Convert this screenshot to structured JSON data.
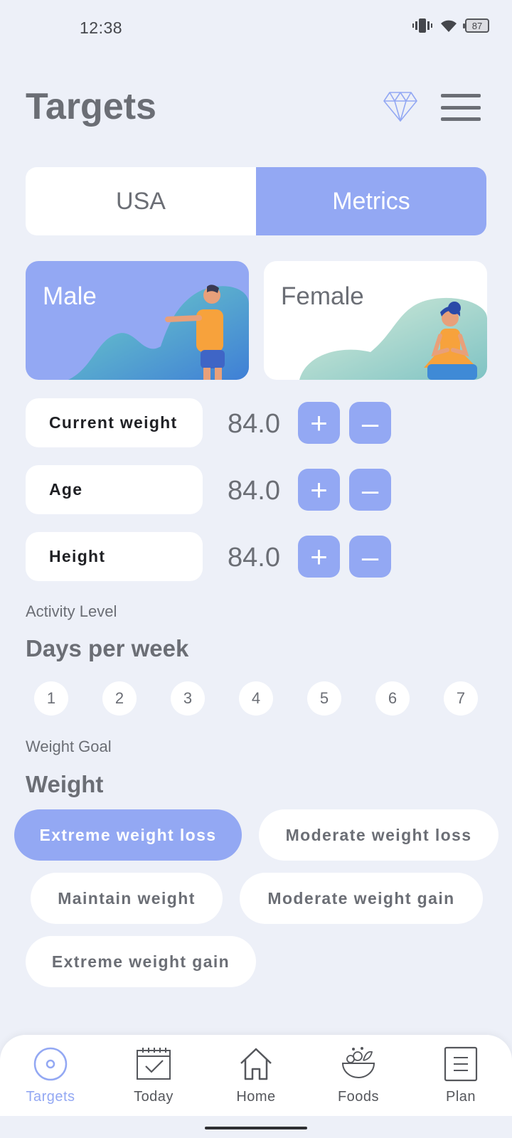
{
  "status_bar": {
    "time": "12:38",
    "battery": "87",
    "icons": [
      "vibrate-icon",
      "wifi-icon",
      "battery-icon"
    ]
  },
  "header": {
    "title": "Targets",
    "premium_icon": "diamond-icon",
    "menu_icon": "hamburger-menu-icon"
  },
  "unit_toggle": {
    "options": [
      "USA",
      "Metrics"
    ],
    "selected": "Metrics"
  },
  "gender": {
    "male": "Male",
    "female": "Female",
    "selected": "Male"
  },
  "metrics": [
    {
      "label": "Current weight",
      "value": "84.0"
    },
    {
      "label": "Age",
      "value": "84.0"
    },
    {
      "label": "Height",
      "value": "84.0"
    }
  ],
  "stepper": {
    "plus": "+",
    "minus": "–"
  },
  "activity": {
    "subtitle": "Activity Level",
    "title": "Days per week",
    "days": [
      "1",
      "2",
      "3",
      "4",
      "5",
      "6",
      "7"
    ]
  },
  "weight_goal": {
    "subtitle": "Weight Goal",
    "title": "Weight",
    "options": [
      "Extreme weight loss",
      "Moderate weight loss",
      "Maintain weight",
      "Moderate weight gain",
      "Extreme weight gain"
    ],
    "selected": "Extreme weight loss"
  },
  "bottom_nav": {
    "items": [
      {
        "label": "Targets",
        "icon": "target-icon"
      },
      {
        "label": "Today",
        "icon": "calendar-check-icon"
      },
      {
        "label": "Home",
        "icon": "home-icon"
      },
      {
        "label": "Foods",
        "icon": "salad-bowl-icon"
      },
      {
        "label": "Plan",
        "icon": "plan-list-icon"
      }
    ],
    "active": "Targets"
  },
  "colors": {
    "accent": "#93a8f3",
    "background": "#edf0f8",
    "text": "#6b6e75",
    "card": "#ffffff"
  }
}
